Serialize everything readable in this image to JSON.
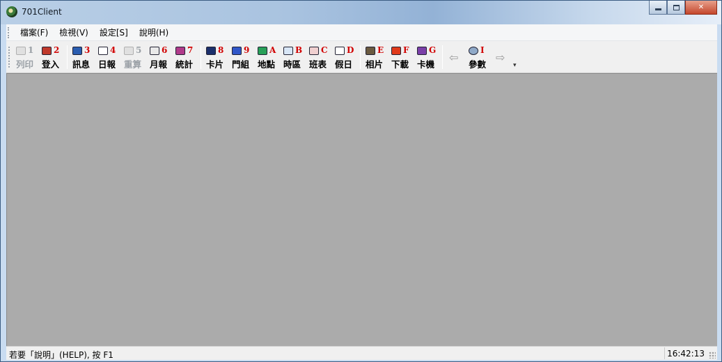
{
  "window": {
    "title": "701Client"
  },
  "menubar": {
    "items": [
      "檔案(F)",
      "檢視(V)",
      "設定[S]",
      "說明(H)"
    ]
  },
  "toolbar": {
    "tools": [
      {
        "key": "1",
        "label": "列印",
        "icon": "printer-icon",
        "enabled": false,
        "color": "#9aa0a6"
      },
      {
        "key": "2",
        "label": "登入",
        "icon": "login-pen-icon",
        "enabled": true,
        "color": "#c0392b"
      },
      {
        "key": "3",
        "label": "訊息",
        "icon": "message-icon",
        "enabled": true,
        "color": "#2a5db0"
      },
      {
        "key": "4",
        "label": "日報",
        "icon": "daily-report-icon",
        "enabled": true,
        "color": "#ffffff"
      },
      {
        "key": "5",
        "label": "重算",
        "icon": "recalculate-icon",
        "enabled": false,
        "color": "#9aa0a6"
      },
      {
        "key": "6",
        "label": "月報",
        "icon": "monthly-report-icon",
        "enabled": true,
        "color": "#e9e9e9"
      },
      {
        "key": "7",
        "label": "統計",
        "icon": "statistics-icon",
        "enabled": true,
        "color": "#b03a8a"
      },
      {
        "key": "8",
        "label": "卡片",
        "icon": "card-icon",
        "enabled": true,
        "color": "#1b2f6b"
      },
      {
        "key": "9",
        "label": "門組",
        "icon": "door-group-icon",
        "enabled": true,
        "color": "#3056c8"
      },
      {
        "key": "A",
        "label": "地點",
        "icon": "location-map-icon",
        "enabled": true,
        "color": "#28a058"
      },
      {
        "key": "B",
        "label": "時區",
        "icon": "time-zone-clock-icon",
        "enabled": true,
        "color": "#d8e6f6"
      },
      {
        "key": "C",
        "label": "班表",
        "icon": "shift-schedule-icon",
        "enabled": true,
        "color": "#f0d0d0"
      },
      {
        "key": "D",
        "label": "假日",
        "icon": "holiday-bicycle-icon",
        "enabled": true,
        "color": "#ffffff"
      },
      {
        "key": "E",
        "label": "相片",
        "icon": "photo-icon",
        "enabled": true,
        "color": "#6a5a40"
      },
      {
        "key": "F",
        "label": "下載",
        "icon": "download-icon",
        "enabled": true,
        "color": "#e03a1a"
      },
      {
        "key": "G",
        "label": "卡機",
        "icon": "card-reader-icon",
        "enabled": true,
        "color": "#7a3fa8"
      }
    ],
    "nav": {
      "back_icon": "back-arrow-icon",
      "params_key": "I",
      "params_label": "參數",
      "forward_icon": "forward-arrow-icon"
    }
  },
  "statusbar": {
    "help_text": "若要「說明」(HELP), 按 F1",
    "clock": "16:42:13"
  }
}
